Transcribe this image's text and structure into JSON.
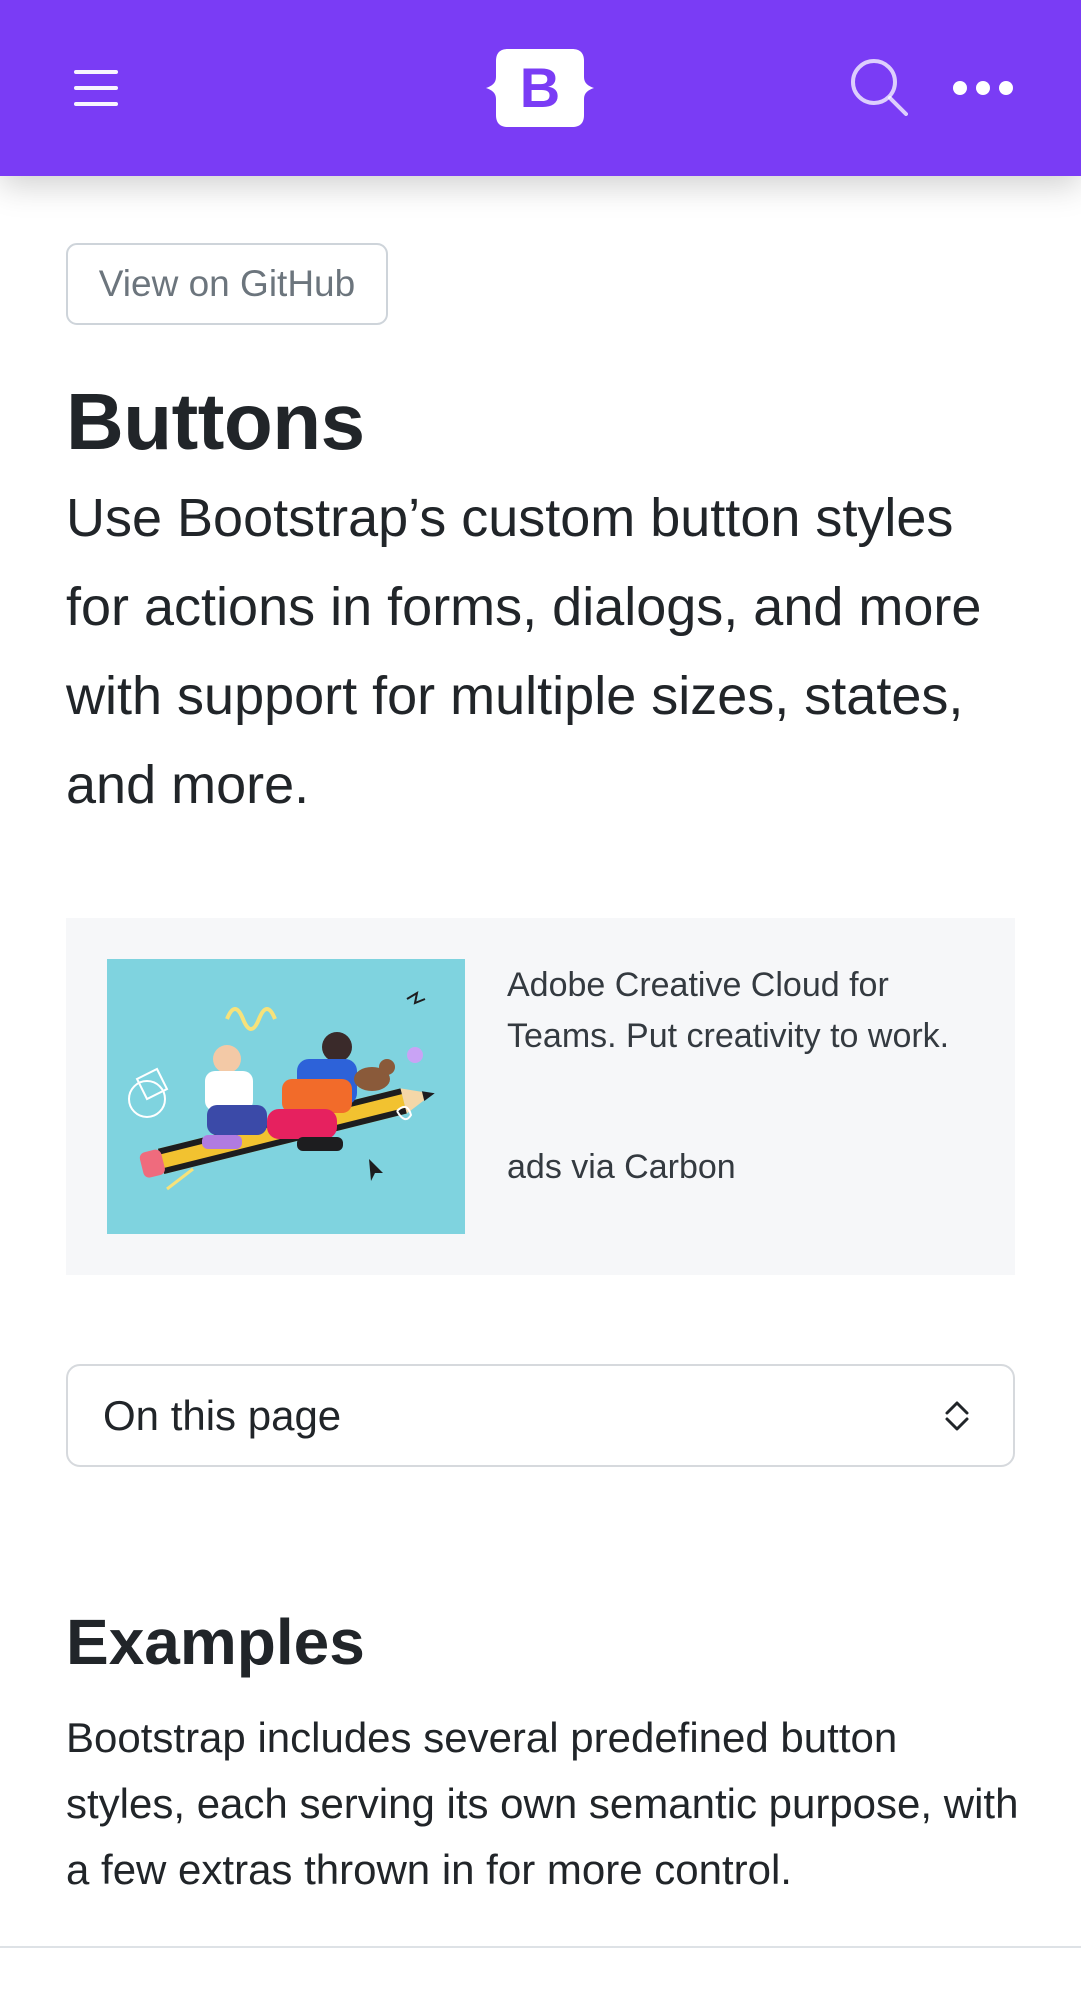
{
  "navbar": {
    "background": "#7a3cf5",
    "menu_icon": "hamburger-menu-icon",
    "brand_icon": "bootstrap-logo",
    "brand_letter": "B",
    "search_icon": "search-icon",
    "more_icon": "more-dots-icon"
  },
  "github_button": {
    "label": "View on GitHub"
  },
  "page": {
    "title": "Buttons",
    "lead": "Use Bootstrap’s custom button styles for actions in forms, dialogs, and more with support for multiple sizes, states, and more."
  },
  "ad": {
    "text": "Adobe Creative Cloud for Teams. Put creativity to work.",
    "via": "ads via Carbon",
    "image_background": "#7fd3df"
  },
  "toc": {
    "selected": "On this page",
    "chevron_icon": "chevron-up-down-icon"
  },
  "examples": {
    "heading": "Examples",
    "body": "Bootstrap includes several predefined button styles, each serving its own semantic purpose, with a few extras thrown in for more control."
  }
}
